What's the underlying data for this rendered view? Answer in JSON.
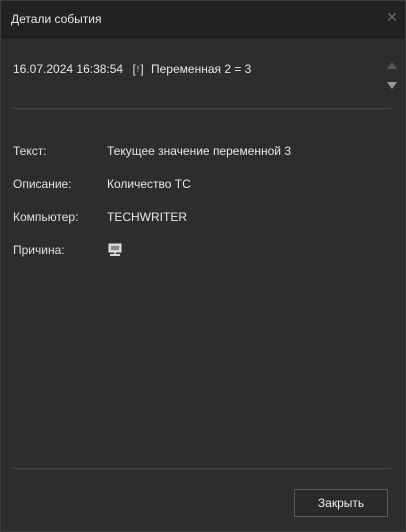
{
  "window": {
    "title": "Детали события",
    "close_icon": "close-icon"
  },
  "event": {
    "timestamp": "16.07.2024 16:38:54",
    "flag_open": "[",
    "flag_mark": "!",
    "flag_close": "]",
    "summary": "Переменная 2 = 3"
  },
  "details": [
    {
      "label": "Текст:",
      "value": "Текущее значение переменной 3"
    },
    {
      "label": "Описание:",
      "value": "Количество ТС"
    },
    {
      "label": "Компьютер:",
      "value": "TECHWRITER"
    },
    {
      "label": "Причина:",
      "value": "",
      "icon": "monitor-icon"
    }
  ],
  "footer": {
    "close_button_label": "Закрыть"
  },
  "colors": {
    "background": "#2d2d2d",
    "titlebar": "#222222",
    "text": "#e0e0e0",
    "divider": "#4a4a4a"
  }
}
